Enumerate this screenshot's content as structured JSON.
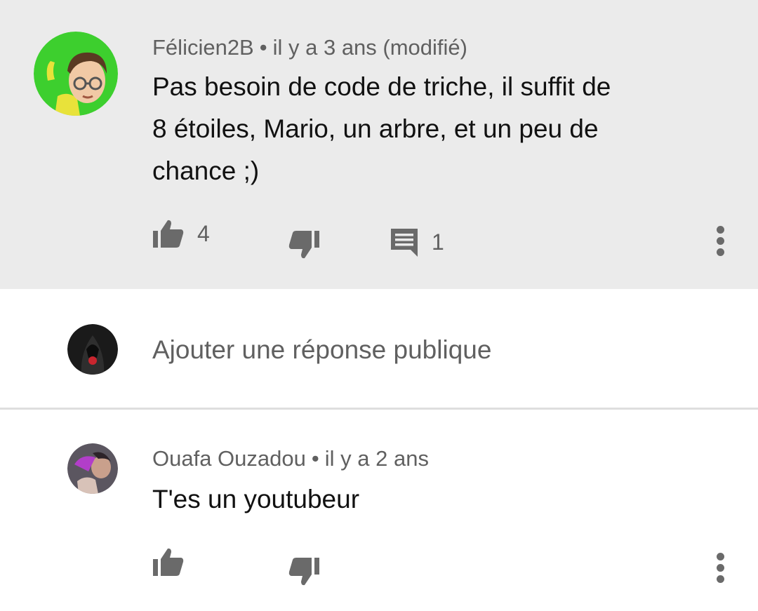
{
  "comments": [
    {
      "author": "Félicien2B",
      "separator": "•",
      "time": "il y a 3 ans (modifié)",
      "text_lines": [
        "Pas besoin de code de triche, il suffit de",
        "8 étoiles, Mario, un arbre, et un peu de",
        "chance ;)"
      ],
      "likes": "4",
      "replies": "1",
      "avatar_icon": "mii-avatar-icon",
      "background": "#ebebeb"
    },
    {
      "author": "Ouafa Ouzadou",
      "separator": "•",
      "time": "il y a 2 ans",
      "text_lines": [
        "T'es un youtubeur"
      ],
      "avatar_icon": "user-photo-avatar-icon"
    }
  ],
  "reply": {
    "placeholder": "Ajouter une réponse publique",
    "avatar_icon": "hooded-figure-avatar-icon"
  },
  "icons": {
    "like": "thumbs-up-icon",
    "dislike": "thumbs-down-icon",
    "reply": "comment-icon",
    "menu": "more-vertical-icon"
  },
  "colors": {
    "icon_gray": "#6a6a6a",
    "meta_text": "#606060",
    "avatar_green": "#3dcf2e"
  }
}
